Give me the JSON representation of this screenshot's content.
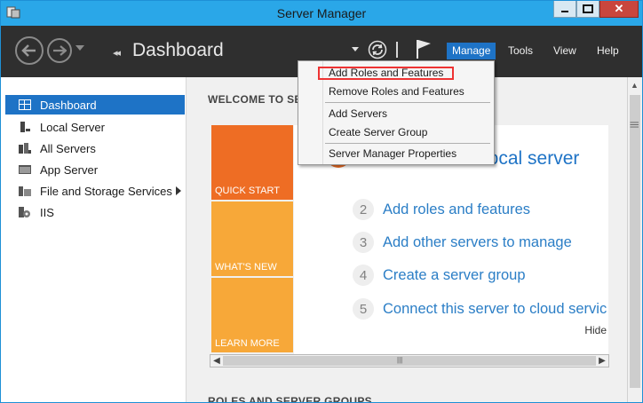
{
  "window": {
    "title": "Server Manager"
  },
  "header": {
    "page_title": "Dashboard",
    "menu": [
      "Manage",
      "Tools",
      "View",
      "Help"
    ],
    "active_menu": "Manage"
  },
  "sidebar": {
    "items": [
      {
        "label": "Dashboard",
        "icon": "dashboard-icon",
        "selected": true
      },
      {
        "label": "Local Server",
        "icon": "local-server-icon"
      },
      {
        "label": "All Servers",
        "icon": "all-servers-icon"
      },
      {
        "label": "App Server",
        "icon": "app-server-icon"
      },
      {
        "label": "File and Storage Services",
        "icon": "file-storage-icon",
        "has_submenu": true
      },
      {
        "label": "IIS",
        "icon": "iis-icon"
      }
    ]
  },
  "main": {
    "welcome_heading": "WELCOME TO SE",
    "tiles": [
      {
        "label": "QUICK START",
        "color": "#ee6d24"
      },
      {
        "label": "WHAT'S NEW",
        "color": "#f7a839"
      },
      {
        "label": "LEARN MORE",
        "color": "#f7a839"
      }
    ],
    "quick_start_title": "local server",
    "steps": [
      {
        "num": "2",
        "text": "Add roles and features"
      },
      {
        "num": "3",
        "text": "Add other servers to manage"
      },
      {
        "num": "4",
        "text": "Create a server group"
      },
      {
        "num": "5",
        "text": "Connect this server to cloud servic"
      }
    ],
    "hide_label": "Hide",
    "roles_heading": "ROLES AND SERVER GROUPS"
  },
  "manage_menu": {
    "items": [
      "Add Roles and Features",
      "Remove Roles and Features",
      "Add Servers",
      "Create Server Group",
      "Server Manager Properties"
    ],
    "highlighted": "Add Roles and Features"
  },
  "colors": {
    "accent": "#1e73c6",
    "header_bg": "#2f2f2f",
    "titlebar": "#2aa7e8",
    "highlight_box": "#ee3333"
  }
}
